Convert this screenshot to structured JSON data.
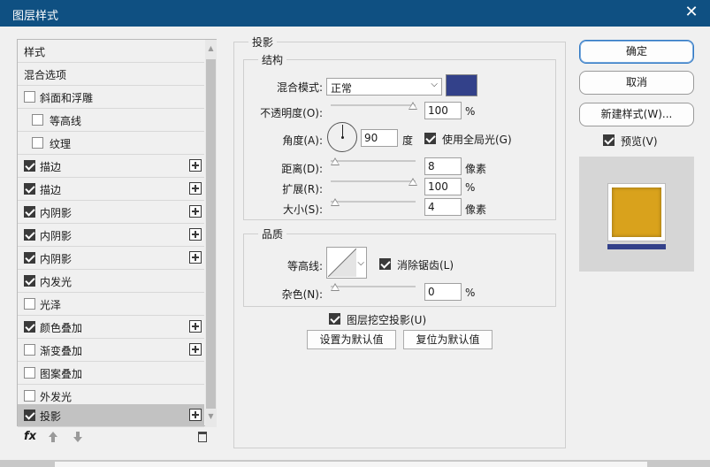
{
  "window": {
    "title": "图层样式",
    "close": "✕"
  },
  "left": {
    "items": [
      {
        "label": "样式"
      },
      {
        "label": "混合选项"
      },
      {
        "label": "斜面和浮雕",
        "checked": false
      },
      {
        "label": "等高线",
        "checked": false
      },
      {
        "label": "纹理",
        "checked": false
      },
      {
        "label": "描边",
        "checked": true
      },
      {
        "label": "描边",
        "checked": true
      },
      {
        "label": "内阴影",
        "checked": true
      },
      {
        "label": "内阴影",
        "checked": true
      },
      {
        "label": "内阴影",
        "checked": true
      },
      {
        "label": "内发光",
        "checked": true
      },
      {
        "label": "光泽",
        "checked": false
      },
      {
        "label": "颜色叠加",
        "checked": true
      },
      {
        "label": "渐变叠加",
        "checked": false
      },
      {
        "label": "图案叠加",
        "checked": false
      },
      {
        "label": "外发光",
        "checked": false
      },
      {
        "label": "投影",
        "checked": true
      }
    ],
    "footer": {
      "fx": "fx"
    }
  },
  "shadow": {
    "title": "投影",
    "structure": {
      "title": "结构",
      "blend_mode_label": "混合模式:",
      "blend_mode": "正常",
      "shadow_color": "#33418a",
      "opacity_label": "不透明度(O):",
      "opacity": "100",
      "opacity_unit": "%",
      "angle_label": "角度(A):",
      "angle": "90",
      "angle_unit": "度",
      "global_light_label": "使用全局光(G)",
      "distance_label": "距离(D):",
      "distance": "8",
      "distance_unit": "像素",
      "spread_label": "扩展(R):",
      "spread": "100",
      "spread_unit": "%",
      "size_label": "大小(S):",
      "size": "4",
      "size_unit": "像素"
    },
    "quality": {
      "title": "品质",
      "contour_label": "等高线:",
      "antialias_label": "消除锯齿(L)",
      "noise_label": "杂色(N):",
      "noise": "0",
      "noise_unit": "%"
    },
    "knockout_label": "图层挖空投影(U)",
    "make_default": "设置为默认值",
    "reset_default": "复位为默认值"
  },
  "right": {
    "ok": "确定",
    "cancel": "取消",
    "new_style": "新建样式(W)...",
    "preview_label": "预览(V)",
    "preview_fill_color": "#d9a21c"
  }
}
